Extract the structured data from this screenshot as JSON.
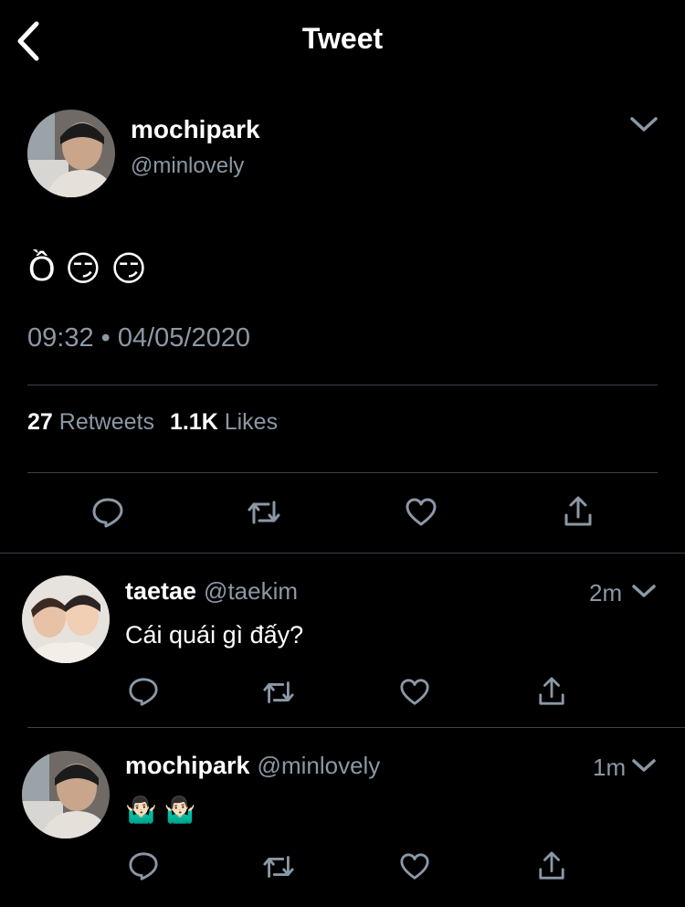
{
  "header": {
    "title": "Tweet"
  },
  "main_tweet": {
    "name": "mochipark",
    "handle": "@minlovely",
    "text": "Ồ 😏 😏",
    "time": "09:32",
    "separator": "•",
    "date": "04/05/2020",
    "retweet_count": "27",
    "retweet_label": "Retweets",
    "like_count": "1.1K",
    "like_label": "Likes"
  },
  "replies": [
    {
      "name": "taetae",
      "handle": "@taekim",
      "time": "2m",
      "text": "Cái quái gì đấy?"
    },
    {
      "name": "mochipark",
      "handle": "@minlovely",
      "time": "1m",
      "text": "🤷🏻‍♂️ 🤷🏻‍♂️"
    }
  ],
  "icons": [
    "back-chevron-icon",
    "chevron-down-icon",
    "reply-icon",
    "retweet-icon",
    "like-icon",
    "share-icon"
  ],
  "colors": {
    "background": "#000000",
    "secondary_text": "#8b98a5",
    "divider": "#38444d",
    "icon": "#8b98a5"
  }
}
